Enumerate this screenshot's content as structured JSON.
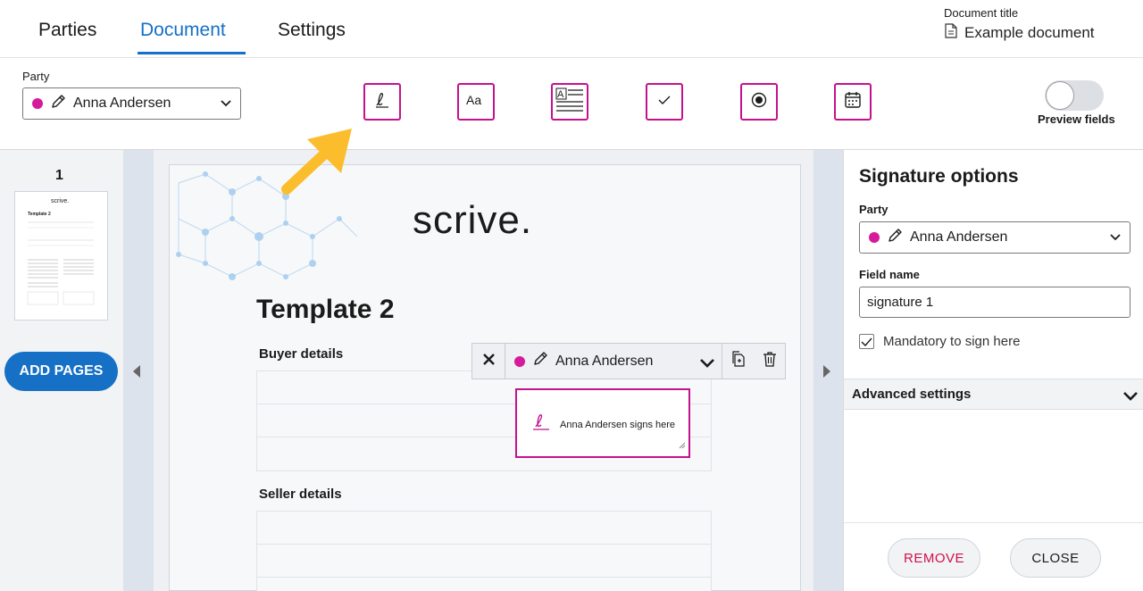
{
  "tabs": [
    {
      "label": "Parties",
      "active": false
    },
    {
      "label": "Document",
      "active": true
    },
    {
      "label": "Settings",
      "active": false
    }
  ],
  "document": {
    "title_label": "Document title",
    "title": "Example document"
  },
  "toolbar": {
    "party_label": "Party",
    "party_value": "Anna Andersen",
    "party_color": "#d61a9b",
    "field_types": [
      {
        "name": "signature-field-icon"
      },
      {
        "name": "text-field-icon"
      },
      {
        "name": "textarea-field-icon"
      },
      {
        "name": "checkbox-field-icon"
      },
      {
        "name": "radio-field-icon"
      },
      {
        "name": "date-field-icon"
      }
    ],
    "preview_label": "Preview fields",
    "preview_on": false
  },
  "pages_panel": {
    "page_number": "1",
    "add_pages_label": "ADD PAGES"
  },
  "page": {
    "logo": "scrive.",
    "template_title": "Template 2",
    "buyer_label": "Buyer details",
    "seller_label": "Seller details"
  },
  "field_toolbar": {
    "party": "Anna Andersen"
  },
  "signature_field": {
    "placeholder": "Anna Andersen signs here"
  },
  "options": {
    "title": "Signature options",
    "party_label": "Party",
    "party_value": "Anna Andersen",
    "field_name_label": "Field name",
    "field_name_value": "signature 1",
    "mandatory_label": "Mandatory to sign here",
    "mandatory_checked": true,
    "advanced_label": "Advanced settings",
    "remove_label": "REMOVE",
    "close_label": "CLOSE"
  },
  "colors": {
    "accent_blue": "#1570c6",
    "field_magenta": "#c4128e",
    "remove_red": "#d0114a",
    "arrow_yellow": "#fbbd2c"
  }
}
